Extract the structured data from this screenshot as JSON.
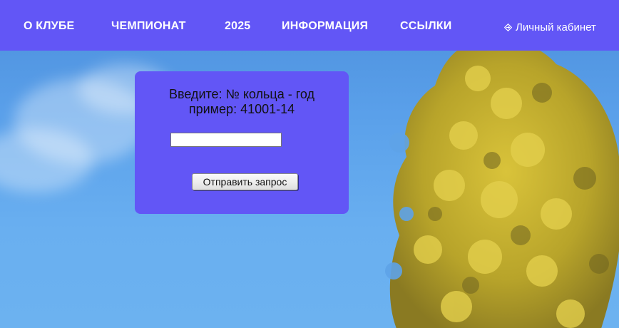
{
  "nav": {
    "items": [
      {
        "label": "О КЛУБЕ"
      },
      {
        "label": "ЧЕМПИОНАТ"
      },
      {
        "label": "2025"
      },
      {
        "label": "ИНФОРМАЦИЯ"
      },
      {
        "label": "ССЫЛКИ"
      }
    ],
    "account": {
      "label": "Личный кабинет",
      "icon": "login-icon"
    }
  },
  "form": {
    "title": "Введите: № кольца - год",
    "example": "пример: 41001-14",
    "input_value": "",
    "input_placeholder": "",
    "submit_label": "Отправить запрос"
  },
  "colors": {
    "nav_background": "#6256f6",
    "panel_background": "#6256f6",
    "nav_text": "#ffffff"
  }
}
